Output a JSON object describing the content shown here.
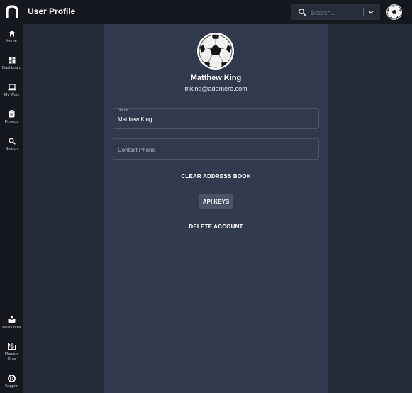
{
  "app": {
    "title": "User Profile",
    "brand_icon": "n-logo-icon"
  },
  "search": {
    "placeholder": "Search...",
    "icon": "search-icon",
    "dropdown_icon": "chevron-down-icon"
  },
  "header": {
    "avatar_icon": "soccer-ball-avatar"
  },
  "sidebar": {
    "items": [
      {
        "label": "Home",
        "icon": "home-icon"
      },
      {
        "label": "Dashboard",
        "icon": "dashboard-icon"
      },
      {
        "label": "My Work",
        "icon": "laptop-icon"
      },
      {
        "label": "Projects",
        "icon": "clipboard-icon"
      },
      {
        "label": "Search",
        "icon": "search-icon"
      }
    ],
    "bottom_items": [
      {
        "label": "Resources",
        "icon": "resources-icon"
      },
      {
        "label_line1": "Manage",
        "label_line2": "Orgs",
        "icon": "building-icon"
      },
      {
        "label": "Support",
        "icon": "lifebuoy-icon"
      }
    ]
  },
  "profile": {
    "name": "Matthew King",
    "email": "mking@ademero.com",
    "avatar_icon": "soccer-ball-avatar",
    "name_field": {
      "label": "Name",
      "value": "Matthew King"
    },
    "phone_field": {
      "placeholder": "Contact Phone",
      "value": ""
    },
    "clear_address_book_label": "CLEAR ADDRESS BOOK",
    "api_keys_label": "API KEYS",
    "delete_account_label": "DELETE ACCOUNT"
  },
  "colors": {
    "topbar": "#15181f",
    "sidebar": "#15181f",
    "side_columns": "#262b3a",
    "main_panel": "#323a4e",
    "button": "#4a5265"
  }
}
